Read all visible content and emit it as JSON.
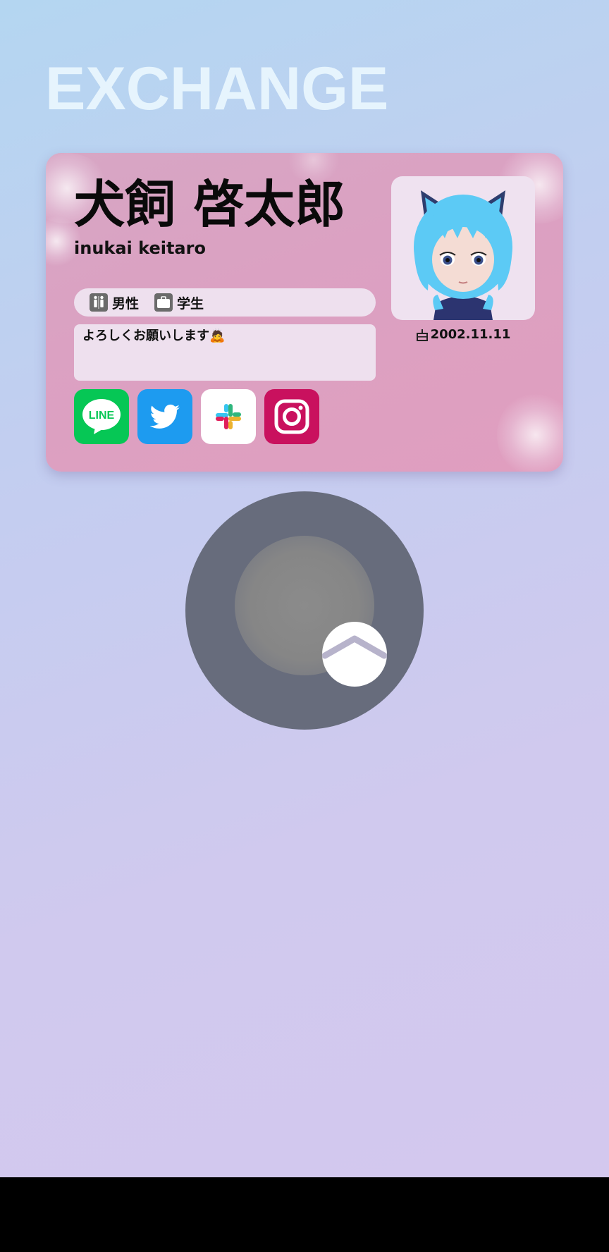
{
  "header": {
    "title": "EXCHANGE"
  },
  "profile_card": {
    "name_jp": "犬飼 啓太郎",
    "name_en": "inukai keitaro",
    "tags": [
      {
        "icon": "restroom-icon",
        "label": "男性"
      },
      {
        "icon": "briefcase-icon",
        "label": "学生"
      }
    ],
    "message": "よろしくお願いします🙇",
    "birthday": "2002.11.11",
    "birthday_icon": "cake-icon",
    "avatar": "avatar-cat-ear-character",
    "sns": [
      {
        "name": "LINE",
        "icon": "line-icon",
        "color": "#06c755",
        "label": "LINE"
      },
      {
        "name": "Twitter",
        "icon": "twitter-icon",
        "color": "#1d9bf0"
      },
      {
        "name": "Slack",
        "icon": "slack-icon",
        "color": "#ffffff"
      },
      {
        "name": "Instagram",
        "icon": "instagram-icon",
        "color": "#c9115e"
      }
    ]
  },
  "swipe_control": {
    "icon": "chevron-up-icon"
  },
  "colors": {
    "card_background": "#dba1c2",
    "title_color": "#e6f4fd",
    "swipe_outer": "#676c7c"
  }
}
